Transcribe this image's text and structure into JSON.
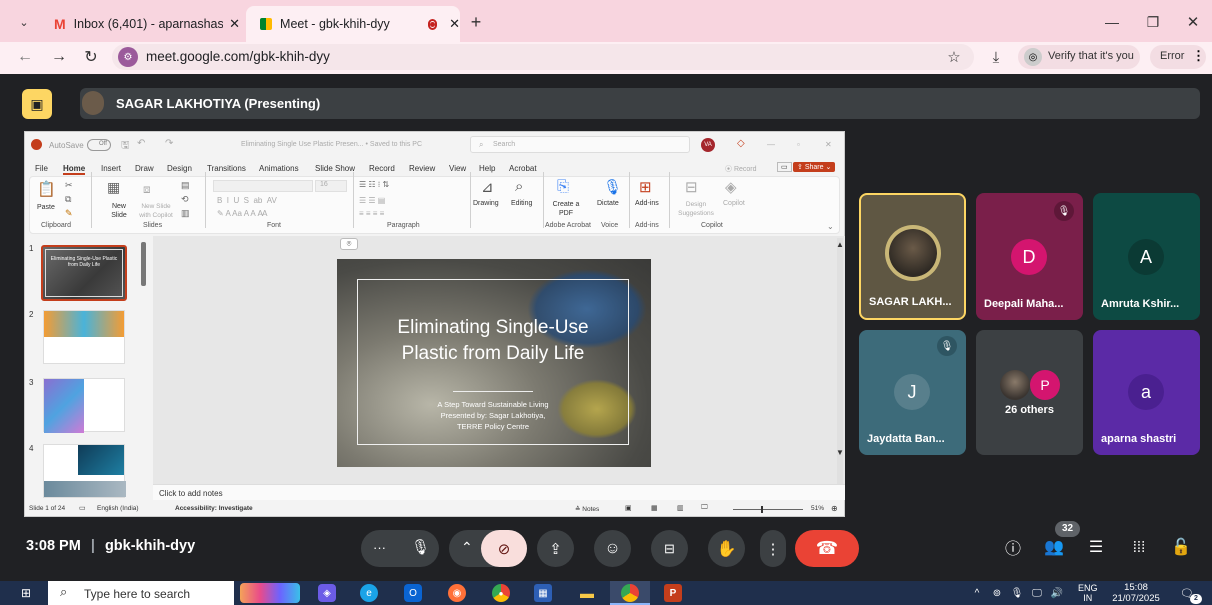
{
  "browser": {
    "tabs": [
      {
        "label": "Inbox (6,401) - aparnashastri@",
        "icon": "gmail-icon"
      },
      {
        "label": "Meet - gbk-khih-dyy",
        "icon": "meet-icon"
      }
    ],
    "url": "meet.google.com/gbk-khih-dyy",
    "verify_label": "Verify that it's you",
    "error_label": "Error"
  },
  "meet": {
    "presenter_label": "SAGAR LAKHOTIYA (Presenting)",
    "time": "3:08 PM",
    "meeting_code": "gbk-khih-dyy",
    "people_count": "32",
    "participants": [
      {
        "name": "SAGAR LAKH...",
        "initial": ""
      },
      {
        "name": "Deepali Maha...",
        "initial": "D"
      },
      {
        "name": "Amruta Kshir...",
        "initial": "A"
      },
      {
        "name": "Jaydatta Ban...",
        "initial": "J"
      },
      {
        "name": "26 others",
        "initial": "P"
      },
      {
        "name": "aparna shastri",
        "initial": "a"
      }
    ],
    "colors": {
      "accent_red": "#ea4335",
      "active_border": "#fdd663"
    }
  },
  "ppt": {
    "autosave": "AutoSave",
    "autosave_state": "Off",
    "doc_title": "Eliminating Single Use Plastic Presen... • Saved to this PC",
    "search_placeholder": "Search",
    "user_initials": "VA",
    "menu": [
      "File",
      "Home",
      "Insert",
      "Draw",
      "Design",
      "Transitions",
      "Animations",
      "Slide Show",
      "Record",
      "Review",
      "View",
      "Help",
      "Acrobat"
    ],
    "record_label": "Record",
    "share_label": "Share",
    "ribbon": {
      "paste": "Paste",
      "new_slide": "New Slide",
      "new_slide_copilot": "New Slide with Copilot",
      "drawing": "Drawing",
      "editing": "Editing",
      "create_pdf": "Create a PDF",
      "dictate": "Dictate",
      "addins": "Add-ins",
      "design_sugg": "Design Suggestions",
      "copilot": "Copilot",
      "groups": [
        "Clipboard",
        "Slides",
        "Font",
        "Paragraph",
        "Adobe Acrobat",
        "Voice",
        "Add-ins",
        "Copilot"
      ],
      "font_size": "16"
    },
    "thumbnails": [
      "1",
      "2",
      "3",
      "4"
    ],
    "slide": {
      "title": "Eliminating Single-Use Plastic from Daily Life",
      "line1": "A Step Toward Sustainable Living",
      "line2": "Presented by: Sagar Lakhotiya,",
      "line3": "TERRE Policy Centre"
    },
    "notes_placeholder": "Click to add notes",
    "status": {
      "slide_count": "Slide 1 of 24",
      "language": "English (India)",
      "accessibility": "Accessibility: Investigate",
      "notes": "Notes",
      "zoom": "51%"
    }
  },
  "taskbar": {
    "search_placeholder": "Type here to search",
    "lang": "ENG",
    "region": "IN",
    "time": "15:08",
    "date": "21/07/2025",
    "notification_count": "2"
  }
}
